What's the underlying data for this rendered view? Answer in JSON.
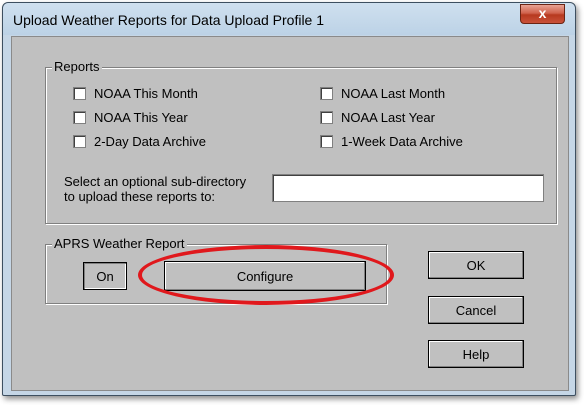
{
  "window": {
    "title": "Upload Weather Reports for Data Upload Profile 1",
    "close_glyph": "x"
  },
  "reports_group": {
    "label": "Reports",
    "checkboxes": [
      {
        "label": "NOAA This Month",
        "checked": false
      },
      {
        "label": "NOAA Last Month",
        "checked": false
      },
      {
        "label": "NOAA This Year",
        "checked": false
      },
      {
        "label": "NOAA Last Year",
        "checked": false
      },
      {
        "label": "2-Day Data Archive",
        "checked": false
      },
      {
        "label": "1-Week Data Archive",
        "checked": false
      }
    ],
    "subdir_label_line1": "Select an optional sub-directory",
    "subdir_label_line2": "to upload these reports to:",
    "subdir_value": ""
  },
  "aprs_group": {
    "label": "APRS Weather Report",
    "on_label": "On",
    "configure_label": "Configure"
  },
  "buttons": {
    "ok": "OK",
    "cancel": "Cancel",
    "help": "Help"
  },
  "colors": {
    "highlight": "#e0181c",
    "dialog_face": "#c0c0c0",
    "frame": "#c5d6e6",
    "close_button": "#c9523a"
  },
  "icons": {
    "close": "close-icon"
  }
}
